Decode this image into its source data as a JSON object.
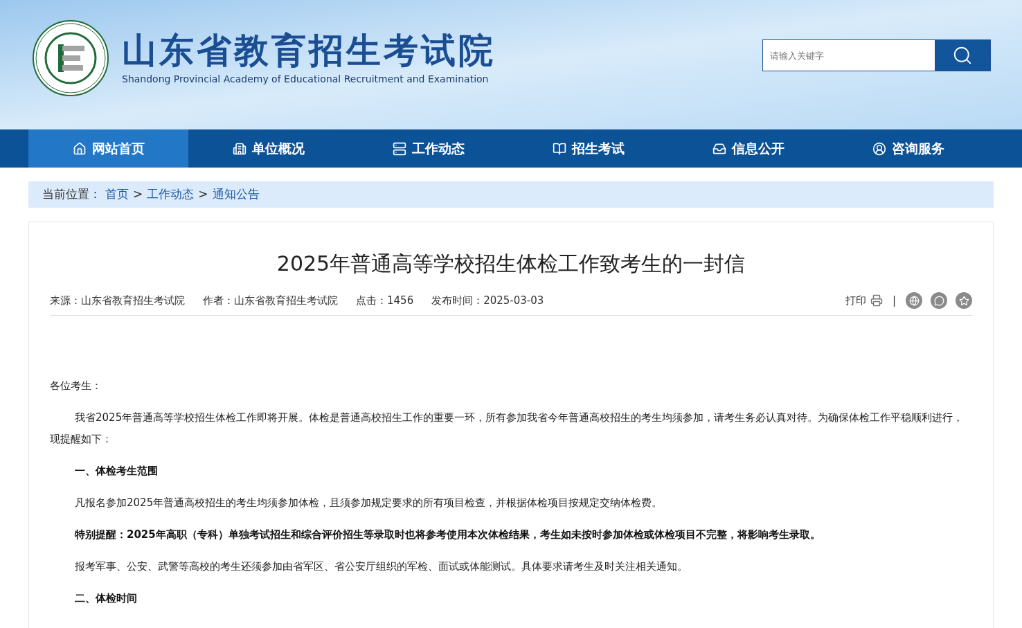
{
  "header": {
    "title": "山东省教育招生考试院",
    "subtitle": "Shandong Provincial Academy of Educational Recruitment and Examination",
    "search": {
      "placeholder": "请输入关键字"
    }
  },
  "nav": [
    {
      "label": "网站首页",
      "selected": true
    },
    {
      "label": "单位概况",
      "selected": false
    },
    {
      "label": "工作动态",
      "selected": false
    },
    {
      "label": "招生考试",
      "selected": false
    },
    {
      "label": "信息公开",
      "selected": false
    },
    {
      "label": "咨询服务",
      "selected": false
    }
  ],
  "breadcrumb": {
    "label": "当前位置：",
    "links": [
      "首页",
      "工作动态",
      "通知公告"
    ],
    "separator": ">"
  },
  "article": {
    "title": "2025年普通高等学校招生体检工作致考生的一封信",
    "meta": [
      "来源：山东省教育招生考试院",
      "作者：山东省教育招生考试院",
      "点击：1456",
      "发布时间：2025-03-03"
    ],
    "print_label": "打印",
    "divider": "|",
    "paragraphs": [
      {
        "kind": "plain",
        "text": "各位考生："
      },
      {
        "kind": "indent",
        "text": "我省2025年普通高等学校招生体检工作即将开展。体检是普通高校招生工作的重要一环，所有参加我省今年普通高校招生的考生均须参加，请考生务必认真对待。为确保体检工作平稳顺利进行，现提醒如下："
      },
      {
        "kind": "heading",
        "text": "一、体检考生范围"
      },
      {
        "kind": "indent",
        "text": "凡报名参加2025年普通高校招生的考生均须参加体检，且须参加规定要求的所有项目检查，并根据体检项目按规定交纳体检费。"
      },
      {
        "kind": "heading",
        "text": "特别提醒：2025年高职（专科）单独考试招生和综合评价招生等录取时也将参考使用本次体检结果，考生如未按时参加体检或体检项目不完整，将影响考生录取。"
      },
      {
        "kind": "indent",
        "text": "报考军事、公安、武警等高校的考生还须参加由省军区、省公安厅组织的军检、面试或体能测试。具体要求请考生及时关注相关通知。"
      },
      {
        "kind": "heading",
        "text": "二、体检时间"
      }
    ]
  }
}
